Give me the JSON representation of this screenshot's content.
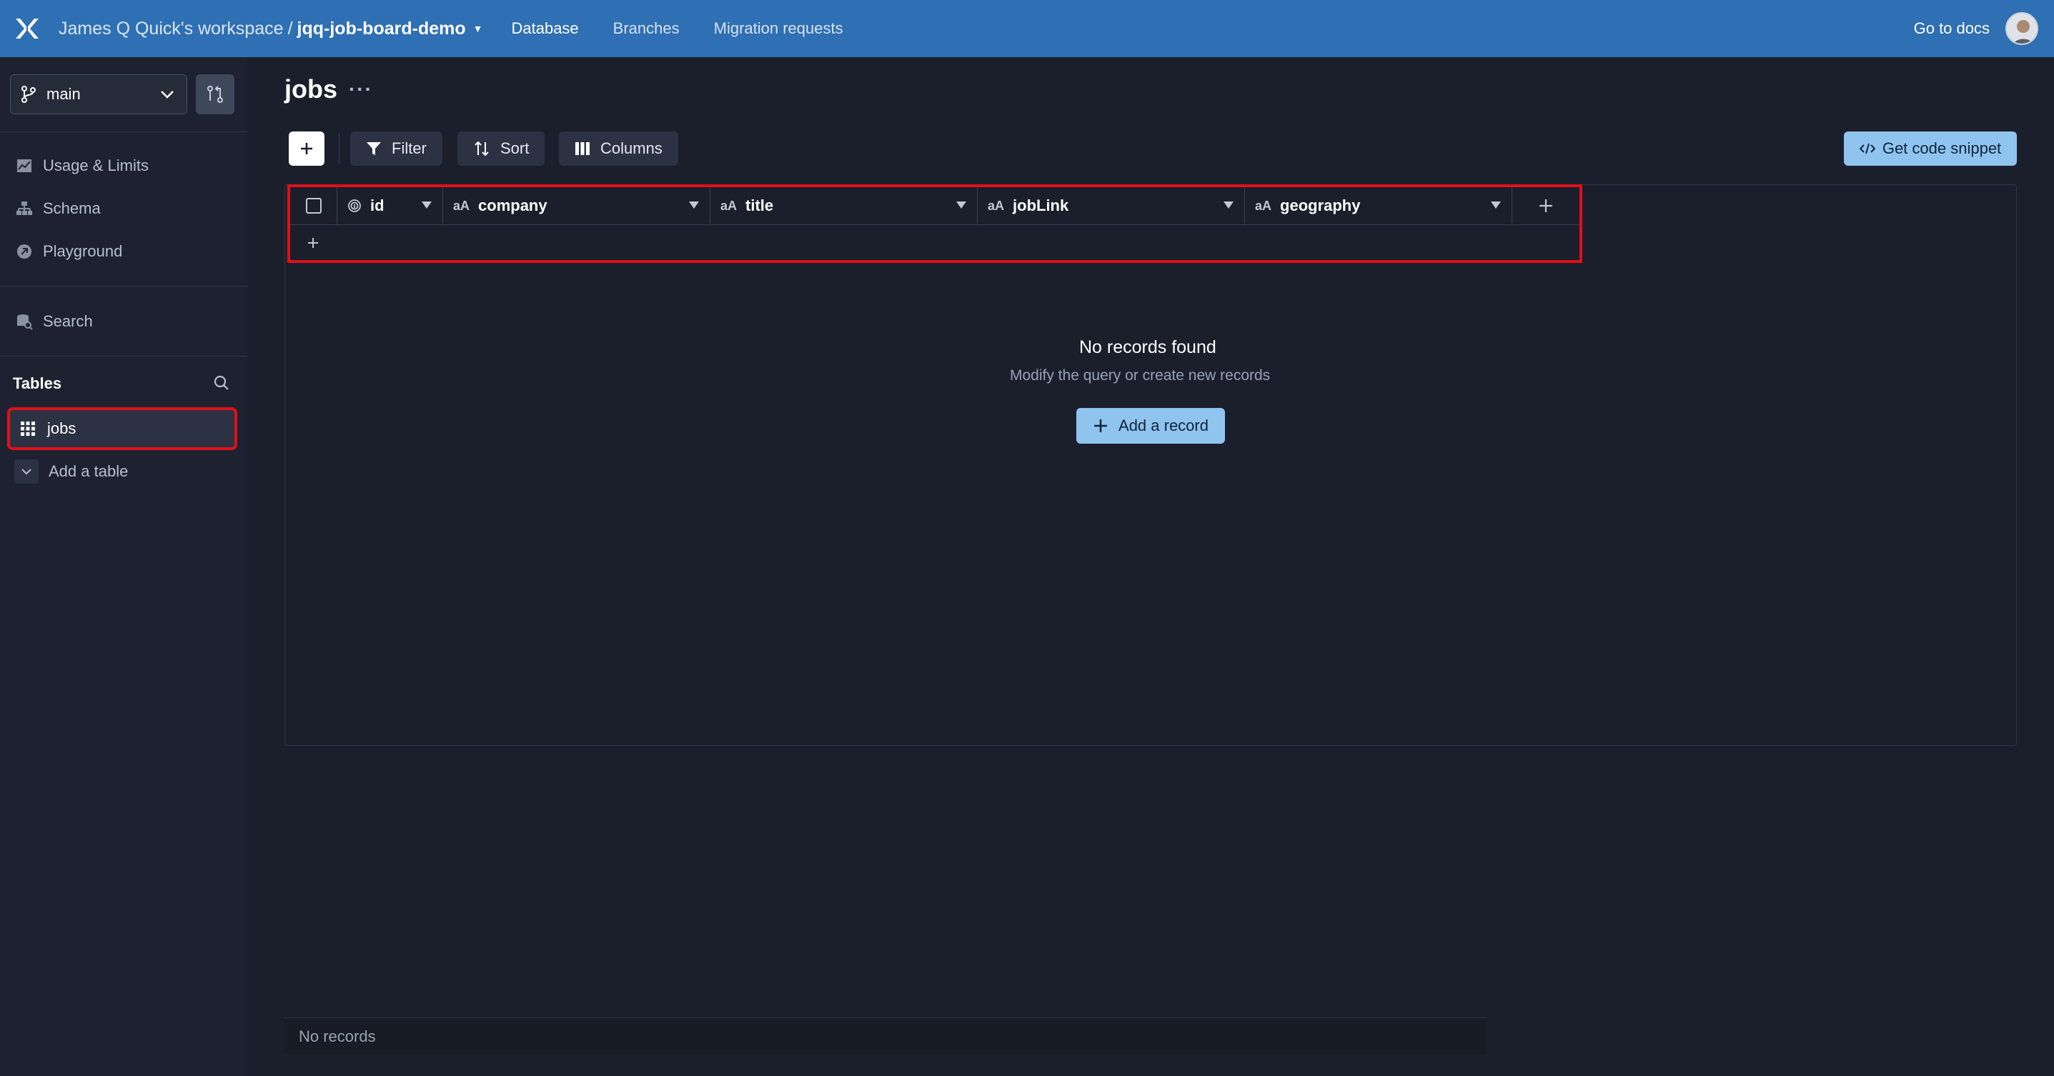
{
  "topbar": {
    "workspace": "James Q Quick's workspace",
    "separator": "/",
    "database": "jqq-job-board-demo",
    "nav": [
      "Database",
      "Branches",
      "Migration requests"
    ],
    "docs": "Go to docs"
  },
  "sidebar": {
    "branch": "main",
    "items": [
      {
        "label": "Usage & Limits",
        "icon": "chart-icon"
      },
      {
        "label": "Schema",
        "icon": "schema-icon"
      },
      {
        "label": "Playground",
        "icon": "playground-icon"
      },
      {
        "label": "Search",
        "icon": "search-db-icon"
      }
    ],
    "tables_heading": "Tables",
    "tables": [
      {
        "label": "jobs"
      }
    ],
    "add_table": "Add a table"
  },
  "main": {
    "title": "jobs",
    "more": "···",
    "toolbar": {
      "filter": "Filter",
      "sort": "Sort",
      "columns": "Columns",
      "snippet": "Get code snippet"
    },
    "columns": [
      {
        "type": "",
        "name": "id"
      },
      {
        "type": "aA",
        "name": "company"
      },
      {
        "type": "aA",
        "name": "title"
      },
      {
        "type": "aA",
        "name": "jobLink"
      },
      {
        "type": "aA",
        "name": "geography"
      }
    ],
    "empty_title": "No records found",
    "empty_subtitle": "Modify the query or create new records",
    "add_record": "Add a record",
    "footer": "No records"
  },
  "colors": {
    "topbar": "#2f6fb3",
    "background": "#1b1f2b",
    "sidebar": "#1e2230",
    "accent_button": "#8fc4ef",
    "highlight": "#e0101a"
  }
}
